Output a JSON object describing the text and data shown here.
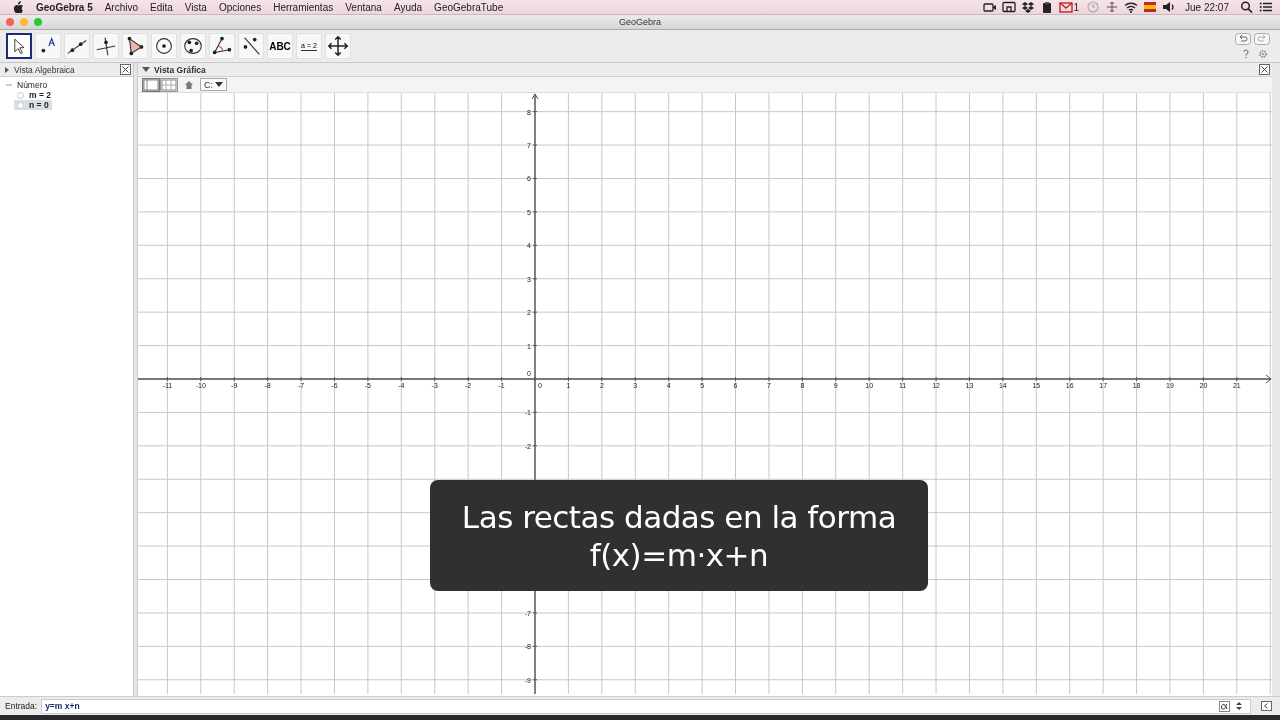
{
  "menu_bar": {
    "app_name": "GeoGebra 5",
    "items": [
      "Archivo",
      "Edita",
      "Vista",
      "Opciones",
      "Herramientas",
      "Ventana",
      "Ayuda",
      "GeoGebraTube"
    ],
    "mail_count": "1",
    "clock": "Jue 22:07"
  },
  "window": {
    "title": "GeoGebra"
  },
  "toolbar": {
    "tools": [
      {
        "kind": "move",
        "selected": true
      },
      {
        "kind": "point",
        "selected": false
      },
      {
        "kind": "line",
        "selected": false
      },
      {
        "kind": "perpendicular",
        "selected": false
      },
      {
        "kind": "polygon",
        "selected": false
      },
      {
        "kind": "circle",
        "selected": false
      },
      {
        "kind": "conic",
        "selected": false
      },
      {
        "kind": "angle",
        "selected": false
      },
      {
        "kind": "reflect",
        "selected": false
      },
      {
        "kind": "text",
        "label": "ABC",
        "selected": false
      },
      {
        "kind": "slider",
        "label": "a = 2",
        "selected": false
      },
      {
        "kind": "move_view",
        "selected": false
      }
    ]
  },
  "algebra_view": {
    "title": "Vista Algebraica",
    "groups": [
      {
        "name": "Número",
        "expanded": true,
        "children": [
          {
            "label": "m = 2",
            "shown": false,
            "selected": false
          },
          {
            "label": "n = 0",
            "shown": false,
            "selected": true
          }
        ]
      }
    ]
  },
  "graphics_view": {
    "title": "Vista Gráfica",
    "point_capture": "C:",
    "x_labels": [
      "-11",
      "-10",
      "-9",
      "-8",
      "-7",
      "-6",
      "-5",
      "-4",
      "-3",
      "-2",
      "-1",
      "0",
      "1",
      "2",
      "3",
      "4",
      "5",
      "6",
      "7",
      "8",
      "9",
      "10",
      "11",
      "12",
      "13",
      "14",
      "15",
      "16",
      "17",
      "18",
      "19",
      "20",
      "21"
    ],
    "y_labels": [
      "8",
      "7",
      "6",
      "5",
      "4",
      "3",
      "2",
      "1",
      "0",
      "-1",
      "-2"
    ],
    "y_labels_below_caption": [
      "-7",
      "-8",
      "-9"
    ],
    "view_toggles": [
      {
        "kind": "axes",
        "selected": true
      },
      {
        "kind": "grid",
        "selected": false
      }
    ]
  },
  "caption": {
    "lines": [
      "Las rectas dadas en la forma",
      "f(x)=m·x+n"
    ]
  },
  "input_bar": {
    "label": "Entrada:",
    "value": "y=m x+n"
  }
}
